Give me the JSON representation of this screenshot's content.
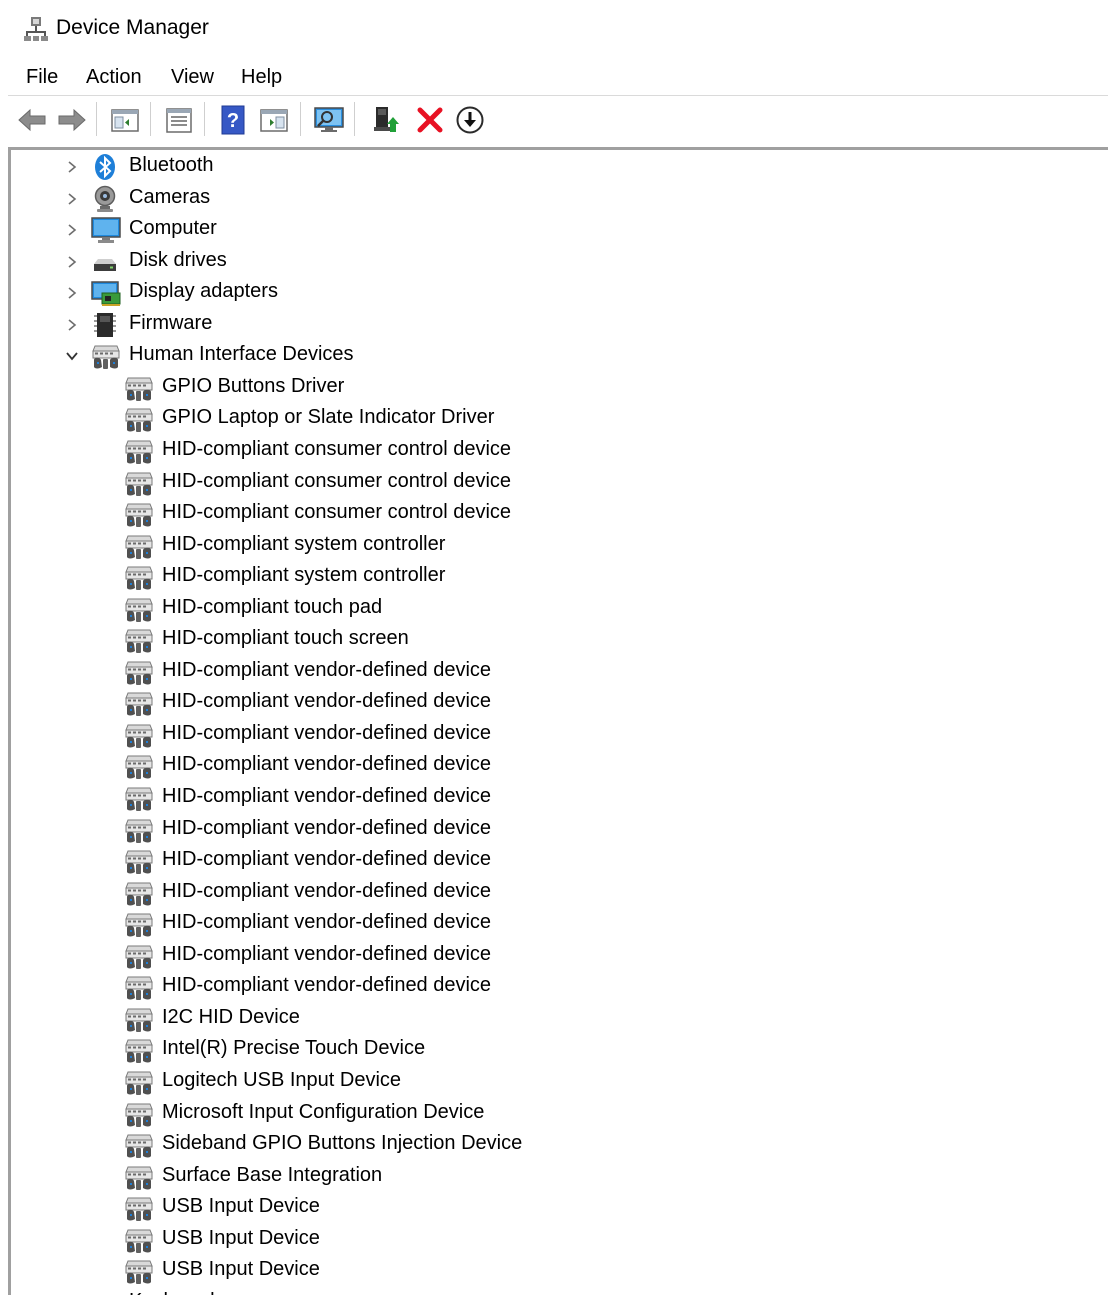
{
  "window": {
    "title": "Device Manager"
  },
  "menu": [
    "File",
    "Action",
    "View",
    "Help"
  ],
  "toolbar": {
    "buttons": [
      "back-arrow-icon",
      "forward-arrow-icon",
      "show-hide-console-tree-icon",
      "properties-icon",
      "help-icon",
      "action-pane-icon",
      "scan-hardware-icon",
      "update-driver-icon",
      "uninstall-device-icon",
      "disable-device-icon"
    ]
  },
  "tree": {
    "categories": [
      {
        "label": "Bluetooth",
        "icon": "bluetooth-icon",
        "expanded": false
      },
      {
        "label": "Cameras",
        "icon": "camera-icon",
        "expanded": false
      },
      {
        "label": "Computer",
        "icon": "computer-monitor-icon",
        "expanded": false
      },
      {
        "label": "Disk drives",
        "icon": "disk-drive-icon",
        "expanded": false
      },
      {
        "label": "Display adapters",
        "icon": "display-adapter-icon",
        "expanded": false
      },
      {
        "label": "Firmware",
        "icon": "firmware-chip-icon",
        "expanded": false
      },
      {
        "label": "Human Interface Devices",
        "icon": "hid-icon",
        "expanded": true
      }
    ],
    "hid_children": [
      "GPIO Buttons Driver",
      "GPIO Laptop or Slate Indicator Driver",
      "HID-compliant consumer control device",
      "HID-compliant consumer control device",
      "HID-compliant consumer control device",
      "HID-compliant system controller",
      "HID-compliant system controller",
      "HID-compliant touch pad",
      "HID-compliant touch screen",
      "HID-compliant vendor-defined device",
      "HID-compliant vendor-defined device",
      "HID-compliant vendor-defined device",
      "HID-compliant vendor-defined device",
      "HID-compliant vendor-defined device",
      "HID-compliant vendor-defined device",
      "HID-compliant vendor-defined device",
      "HID-compliant vendor-defined device",
      "HID-compliant vendor-defined device",
      "HID-compliant vendor-defined device",
      "HID-compliant vendor-defined device",
      "I2C HID Device",
      "Intel(R) Precise Touch Device",
      "Logitech USB Input Device",
      "Microsoft Input Configuration Device",
      "Sideband GPIO Buttons Injection Device",
      "Surface Base Integration",
      "USB Input Device",
      "USB Input Device",
      "USB Input Device"
    ],
    "partial_next_category": {
      "label": "Keyboards",
      "icon": "keyboard-icon"
    }
  },
  "colors": {
    "uninstall_red": "#e81123",
    "bluetooth_blue": "#1e7fd8",
    "border_gray": "#a0a0a0"
  }
}
